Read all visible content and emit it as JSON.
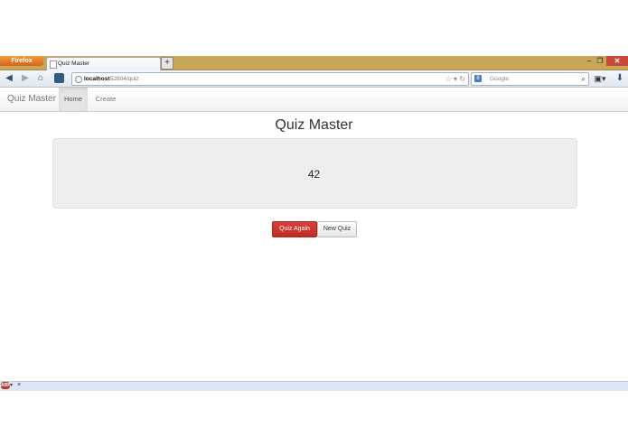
{
  "browser": {
    "menu_button_label": "Firefox",
    "tab_title": "Quiz Master",
    "new_tab_label": "+",
    "window_controls": {
      "minimize": "–",
      "maximize": "❐",
      "close": "✕"
    },
    "url_host": "localhost",
    "url_path": ":52804/quiz",
    "search_placeholder": "Google",
    "search_engine_icon": "g-icon",
    "addon_bar_close": "×"
  },
  "app": {
    "brand": "Quiz Master",
    "nav_items": [
      "Home",
      "Create"
    ],
    "page_title": "Quiz Master",
    "answer": "42",
    "buttons": {
      "quiz_again": "Quiz Again",
      "new_quiz": "New Quiz"
    }
  },
  "colors": {
    "primary_danger": "#c9302c",
    "well_background": "#eeeeee",
    "titlebar": "#c8a75b"
  }
}
